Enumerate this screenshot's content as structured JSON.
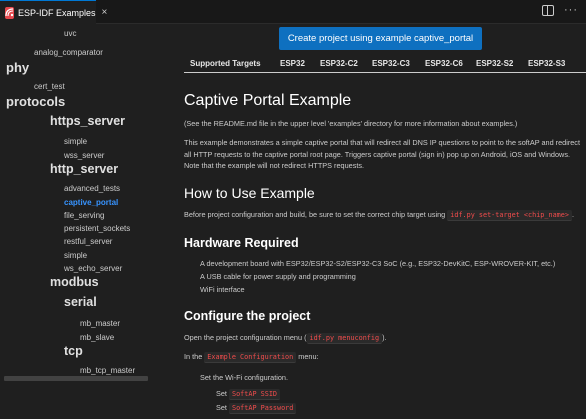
{
  "tab": {
    "title": "ESP-IDF Examples",
    "close": "×",
    "more": "···"
  },
  "sidebar": {
    "items": [
      {
        "label": "uvc",
        "level": "small"
      },
      {
        "label": "analog_comparator",
        "level": "small"
      },
      {
        "label": "phy",
        "level": "big"
      },
      {
        "label": "cert_test",
        "level": "small"
      },
      {
        "label": "protocols",
        "level": "big"
      },
      {
        "label": "https_server",
        "level": "mid"
      },
      {
        "label": "simple",
        "level": "small"
      },
      {
        "label": "wss_server",
        "level": "small"
      },
      {
        "label": "http_server",
        "level": "mid"
      },
      {
        "label": "advanced_tests",
        "level": "small"
      },
      {
        "label": "captive_portal",
        "level": "small",
        "active": true
      },
      {
        "label": "file_serving",
        "level": "small"
      },
      {
        "label": "persistent_sockets",
        "level": "small"
      },
      {
        "label": "restful_server",
        "level": "small"
      },
      {
        "label": "simple",
        "level": "small"
      },
      {
        "label": "ws_echo_server",
        "level": "small"
      },
      {
        "label": "modbus",
        "level": "mid"
      },
      {
        "label": "serial",
        "level": "mid"
      },
      {
        "label": "mb_master",
        "level": "small"
      },
      {
        "label": "mb_slave",
        "level": "small"
      },
      {
        "label": "tcp",
        "level": "mid"
      },
      {
        "label": "mb_tcp_master",
        "level": "small"
      }
    ]
  },
  "content": {
    "create_button": "Create project using example captive_portal",
    "targets": [
      "Supported Targets",
      "ESP32",
      "ESP32-C2",
      "ESP32-C3",
      "ESP32-C6",
      "ESP32-S2",
      "ESP32-S3"
    ],
    "title": "Captive Portal Example",
    "readme_note": "(See the README.md file in the upper level 'examples' directory for more information about examples.)",
    "description": "This example demonstrates a simple captive portal that will redirect all DNS IP questions to point to the softAP and redirect all HTTP requests to the captive portal root page. Triggers captive portal (sign in) pop up on Android, iOS and Windows. Note that the example will not redirect HTTPS requests.",
    "how_to_heading": "How to Use Example",
    "how_to_text": "Before project configuration and build, be sure to set the correct chip target using",
    "how_to_code": "idf.py set-target <chip_name>",
    "how_to_end": ".",
    "hardware_heading": "Hardware Required",
    "hardware_items": [
      "A development board with ESP32/ESP32-S2/ESP32-C3 SoC (e.g., ESP32-DevKitC, ESP-WROVER-KIT, etc.)",
      "A USB cable for power supply and programming",
      "WiFi interface"
    ],
    "configure_heading": "Configure the project",
    "configure_text": "Open the project configuration menu (",
    "configure_code": "idf.py menuconfig",
    "configure_end": ").",
    "menu_text_pre": "In the",
    "menu_code": "Example Configuration",
    "menu_text_post": "menu:",
    "wifi_text": "Set the Wi-Fi configuration.",
    "set_label": "Set",
    "ssid_code": "SoftAP SSID",
    "password_code": "SoftAP Password"
  }
}
